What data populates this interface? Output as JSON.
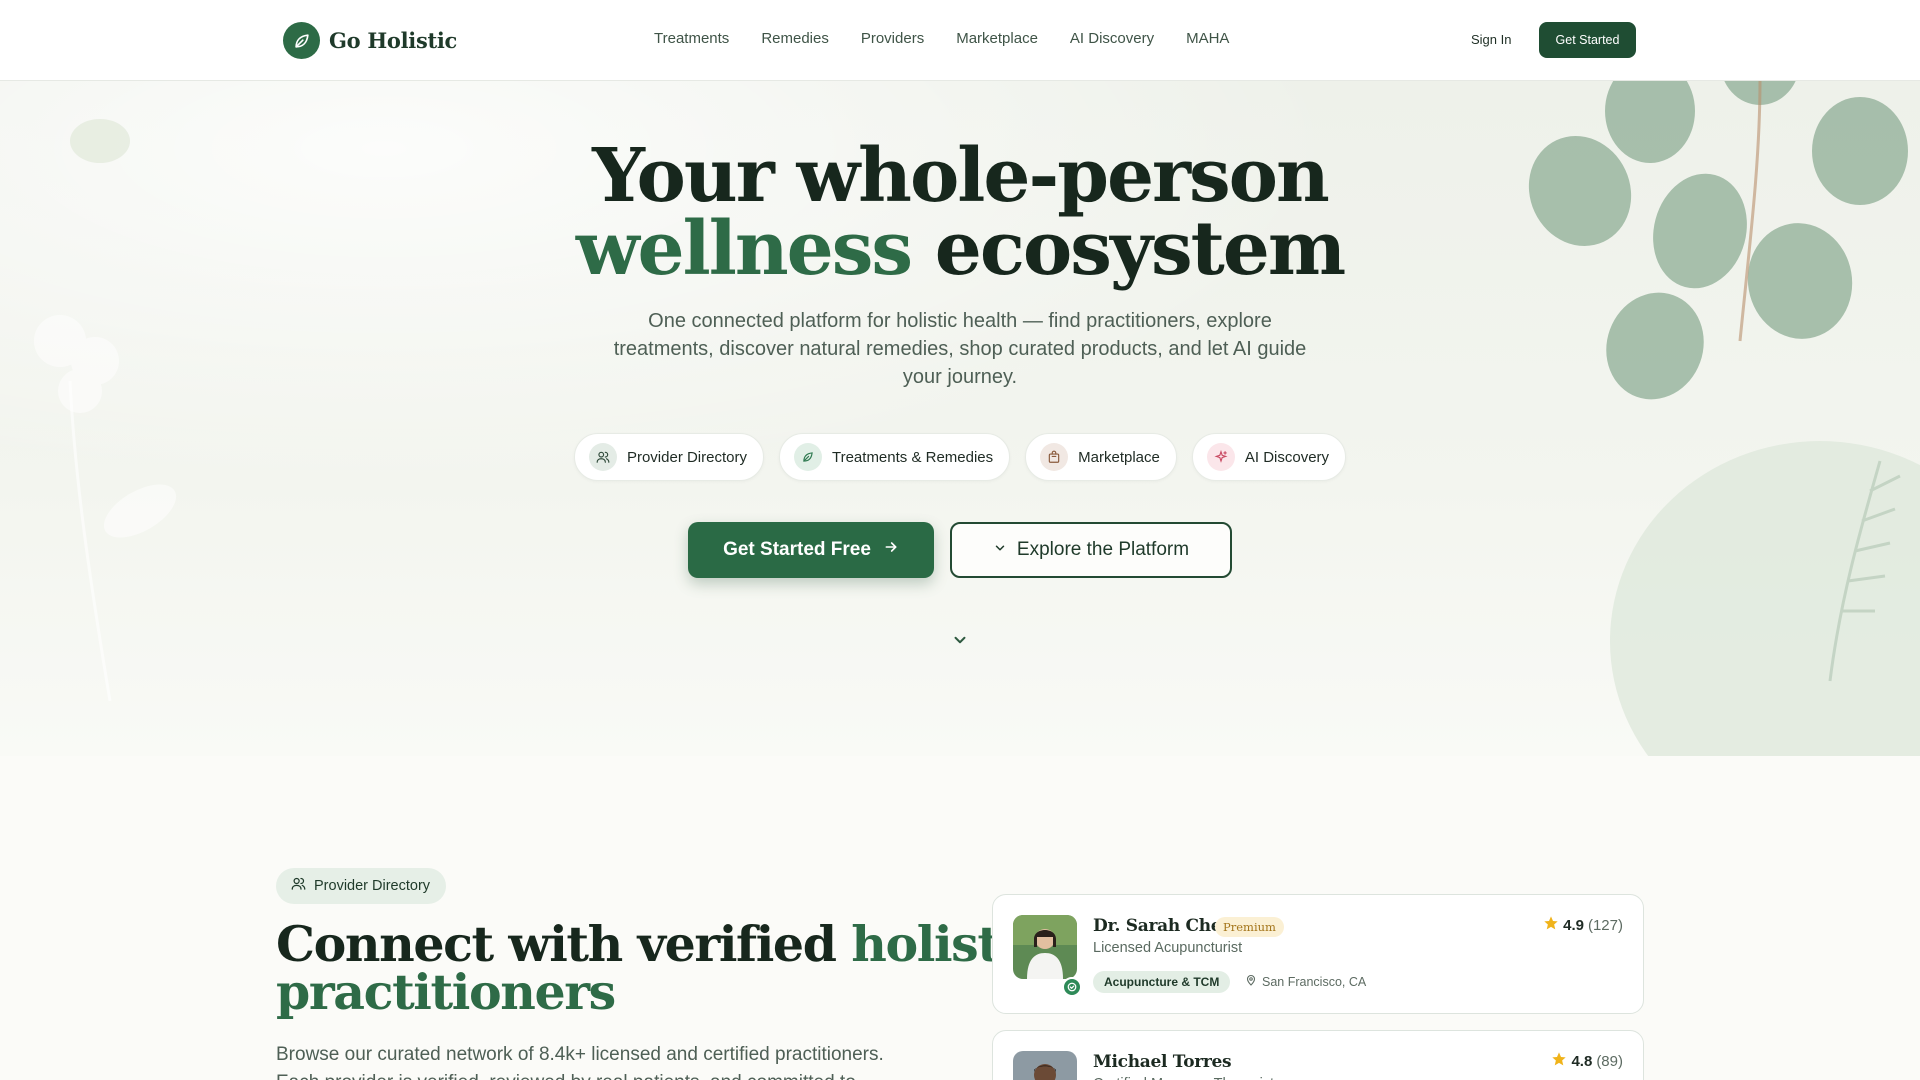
{
  "brand": {
    "name": "Go Holistic"
  },
  "nav": {
    "items": [
      "Treatments",
      "Remedies",
      "Providers",
      "Marketplace",
      "AI Discovery",
      "MAHA"
    ],
    "sign_in": "Sign In",
    "get_started": "Get Started"
  },
  "hero": {
    "title_line1": "Your whole-person",
    "title_line2_green": "wellness",
    "title_line2_rest": "ecosystem",
    "subtitle": "One connected platform for holistic health — find practitioners, explore treatments, discover natural remedies, shop curated products, and let AI guide your journey.",
    "chips": [
      {
        "label": "Provider Directory",
        "icon": "users-icon",
        "color": "#e4ece6"
      },
      {
        "label": "Treatments & Remedies",
        "icon": "leaf-icon",
        "color": "#e1efe6"
      },
      {
        "label": "Marketplace",
        "icon": "shopping-bag-icon",
        "color": "#f1e8e3"
      },
      {
        "label": "AI Discovery",
        "icon": "sparkle-icon",
        "color": "#fbe6ea"
      }
    ],
    "cta_primary": "Get Started Free",
    "cta_secondary": "Explore the Platform"
  },
  "provider_section": {
    "badge": "Provider Directory",
    "title_part1": "Connect with verified",
    "title_green1": "holistic",
    "title_green2": "practitioners",
    "body": "Browse our curated network of 8.4k+ licensed and certified practitioners. Each provider is verified, reviewed by real patients, and committed to"
  },
  "providers": [
    {
      "name": "Dr. Sarah Chen",
      "badge": "Premium",
      "role": "Licensed Acupuncturist",
      "rating": "4.9",
      "reviews": "(127)",
      "tag": "Acupuncture & TCM",
      "location": "San Francisco, CA"
    },
    {
      "name": "Michael Torres",
      "role": "Certified Massage Therapist",
      "rating": "4.8",
      "reviews": "(89)"
    }
  ],
  "colors": {
    "brand_green": "#2d6b46",
    "dark_green": "#1f4d33",
    "accent_text_green": "#2e6b47",
    "star": "#f0b31a"
  }
}
